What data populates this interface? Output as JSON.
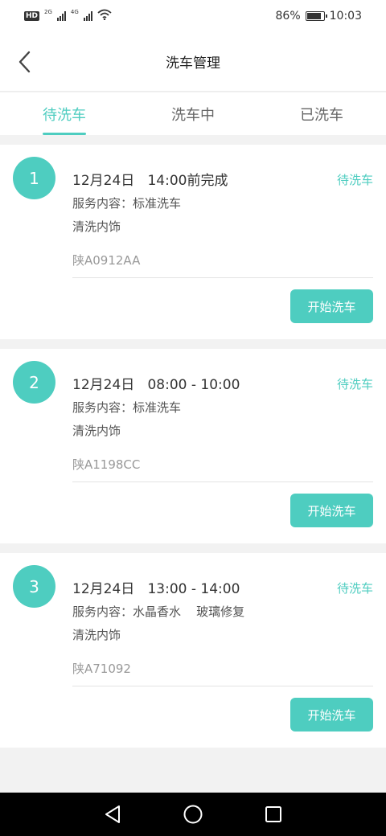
{
  "status_bar": {
    "network_2g": "2G",
    "network_4g": "4G",
    "hd_label": "HD",
    "battery": "86%",
    "time": "10:03"
  },
  "header": {
    "title": "洗车管理"
  },
  "tabs": [
    {
      "label": "待洗车",
      "active": true
    },
    {
      "label": "洗车中",
      "active": false
    },
    {
      "label": "已洗车",
      "active": false
    }
  ],
  "orders": [
    {
      "index": "1",
      "time": "12月24日   14:00前完成",
      "status": "待洗车",
      "service": "服务内容：标准洗车",
      "extra": "清洗内饰",
      "plate": "陕A0912AA",
      "action": "开始洗车"
    },
    {
      "index": "2",
      "time": "12月24日   08:00 - 10:00",
      "status": "待洗车",
      "service": "服务内容：标准洗车",
      "extra": "清洗内饰",
      "plate": "陕A1198CC",
      "action": "开始洗车"
    },
    {
      "index": "3",
      "time": "12月24日   13:00 - 14:00",
      "status": "待洗车",
      "service": "服务内容：水晶香水    玻璃修复",
      "extra": "清洗内饰",
      "plate": "陕A71092",
      "action": "开始洗车"
    }
  ],
  "colors": {
    "accent": "#4ecdc0",
    "background": "#f2f2f2"
  },
  "icons": {
    "back": "chevron-left-icon",
    "nav_back": "triangle-back-icon",
    "nav_home": "circle-home-icon",
    "nav_recent": "square-recent-icon"
  }
}
